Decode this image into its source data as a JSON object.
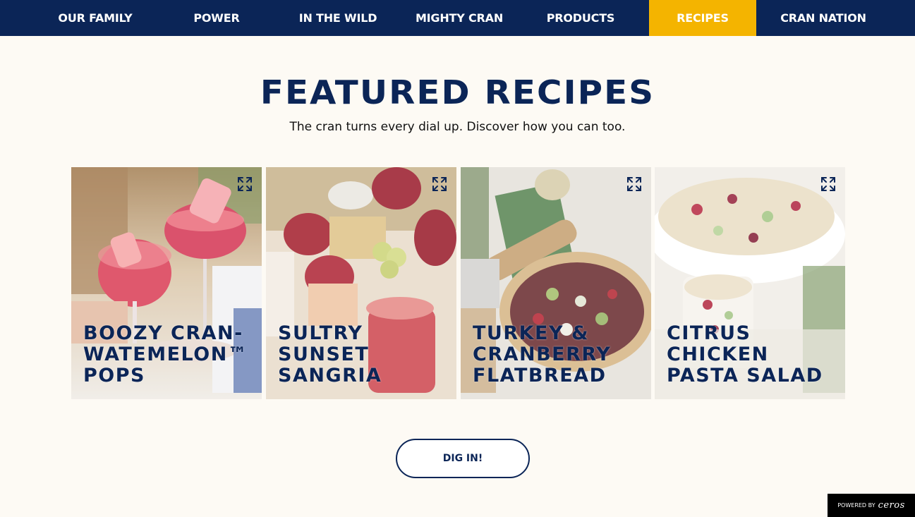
{
  "nav": {
    "items": [
      {
        "label": "OUR FAMILY"
      },
      {
        "label": "POWER"
      },
      {
        "label": "IN THE WILD"
      },
      {
        "label": "MIGHTY CRAN"
      },
      {
        "label": "PRODUCTS"
      },
      {
        "label": "RECIPES",
        "active": true
      },
      {
        "label": "CRAN NATION"
      }
    ]
  },
  "main": {
    "title": "FEATURED RECIPES",
    "subtitle": "The cran turns every dial up. Discover how you can too.",
    "cards": [
      {
        "title": "BOOZY CRAN-WATEMELON™ POPS",
        "icon": "expand-icon"
      },
      {
        "title": "SULTRY SUNSET SANGRIA",
        "icon": "expand-icon"
      },
      {
        "title": "TURKEY & CRANBERRY FLATBREAD",
        "icon": "expand-icon"
      },
      {
        "title": "CITRUS CHICKEN PASTA SALAD",
        "icon": "expand-icon"
      }
    ],
    "cta_label": "DIG IN!"
  },
  "footer_badge": {
    "prefix": "POWERED BY",
    "logo_text": "ceros"
  },
  "colors": {
    "navy": "#0b2557",
    "accent": "#f4b400",
    "background": "#fdfaf4"
  }
}
